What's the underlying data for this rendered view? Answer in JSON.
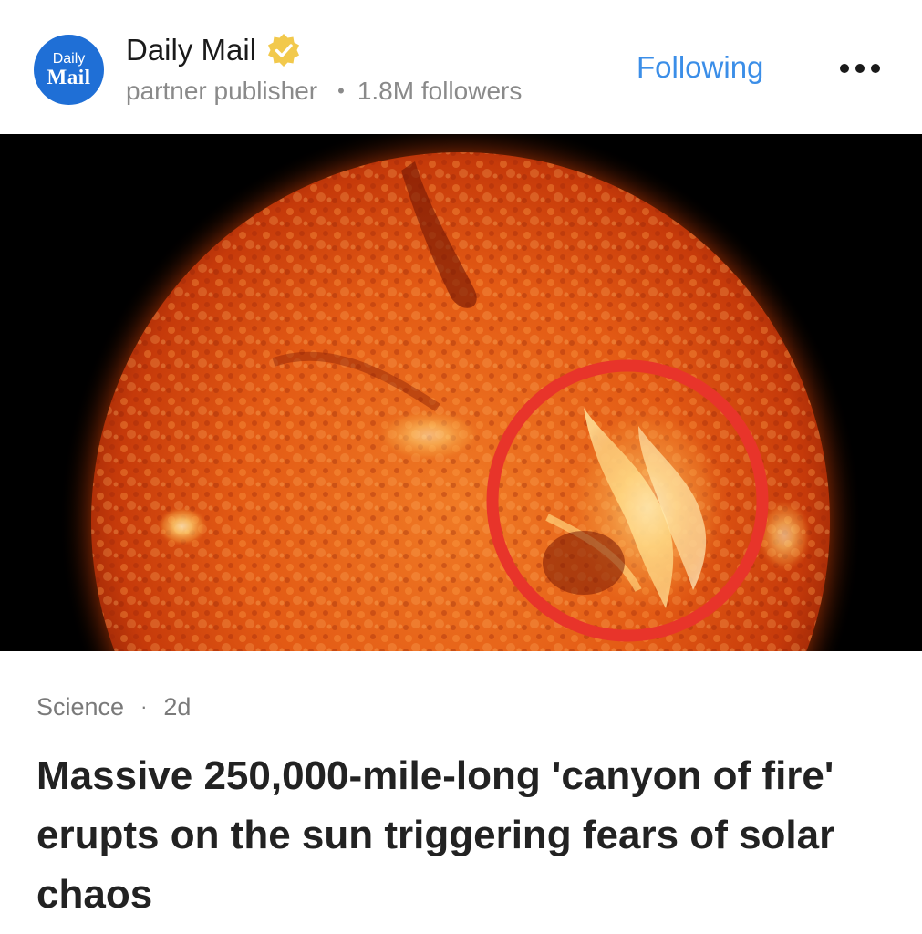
{
  "publisher": {
    "logo_top_text": "Daily",
    "logo_bottom_text": "Mail",
    "name": "Daily Mail",
    "verified_icon": "verified-badge-icon",
    "role": "partner publisher",
    "separator": "•",
    "followers": "1.8M followers",
    "follow_label": "Following",
    "more_icon": "more-horizontal-icon"
  },
  "hero": {
    "image_subject": "sun-solar-flare-image",
    "highlight_icon": "red-circle-highlight"
  },
  "article": {
    "category": "Science",
    "separator": "·",
    "age": "2d",
    "headline": "Massive 250,000-mile-long 'canyon of fire' erupts on the sun triggering fears of solar chaos"
  },
  "colors": {
    "accent": "#3b8ee8",
    "logo_bg": "#1f6fd6",
    "verified": "#f2c94c",
    "highlight": "#e8342a"
  }
}
